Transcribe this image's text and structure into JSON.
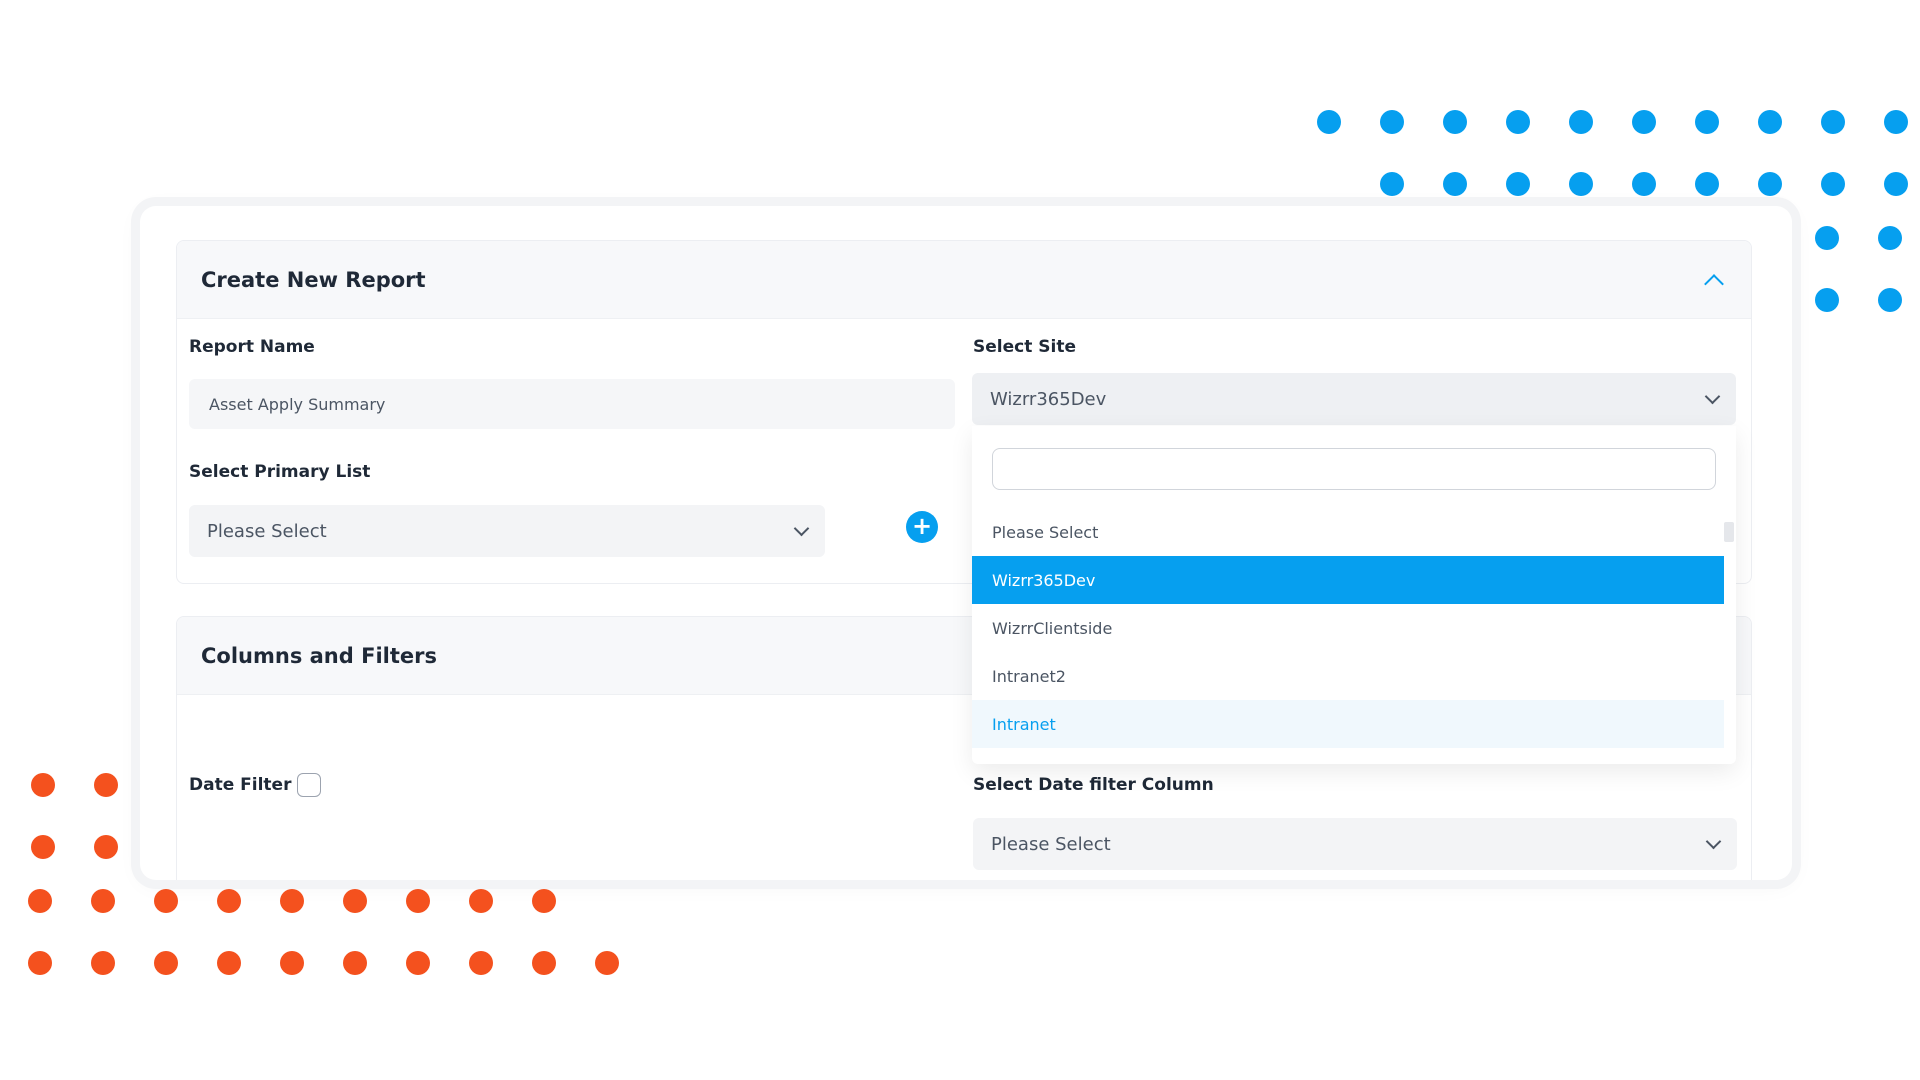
{
  "create_section": {
    "title": "Create New Report",
    "report_name_label": "Report Name",
    "report_name_value": "Asset Apply Summary",
    "select_site_label": "Select Site",
    "select_site_value": "Wizrr365Dev",
    "primary_list_label": "Select Primary List",
    "primary_list_value": "Please Select"
  },
  "columns_section": {
    "title": "Columns and Filters",
    "date_filter_label": "Date Filter",
    "date_filter_column_label": "Select Date filter Column",
    "date_filter_column_value": "Please Select"
  },
  "site_dropdown": {
    "search_value": "",
    "options": [
      {
        "label": "Please Select",
        "state": "default"
      },
      {
        "label": "Wizrr365Dev",
        "state": "selected"
      },
      {
        "label": "WizrrClientside",
        "state": "default"
      },
      {
        "label": "Intranet2",
        "state": "default"
      },
      {
        "label": "Intranet",
        "state": "hover"
      }
    ]
  },
  "colors": {
    "accent": "#069fef",
    "decor_blue": "#069fef",
    "decor_orange": "#f4511e"
  },
  "icons": {
    "collapse": "chevron-up-icon",
    "select": "chevron-down-icon",
    "add": "plus-circle-icon"
  }
}
